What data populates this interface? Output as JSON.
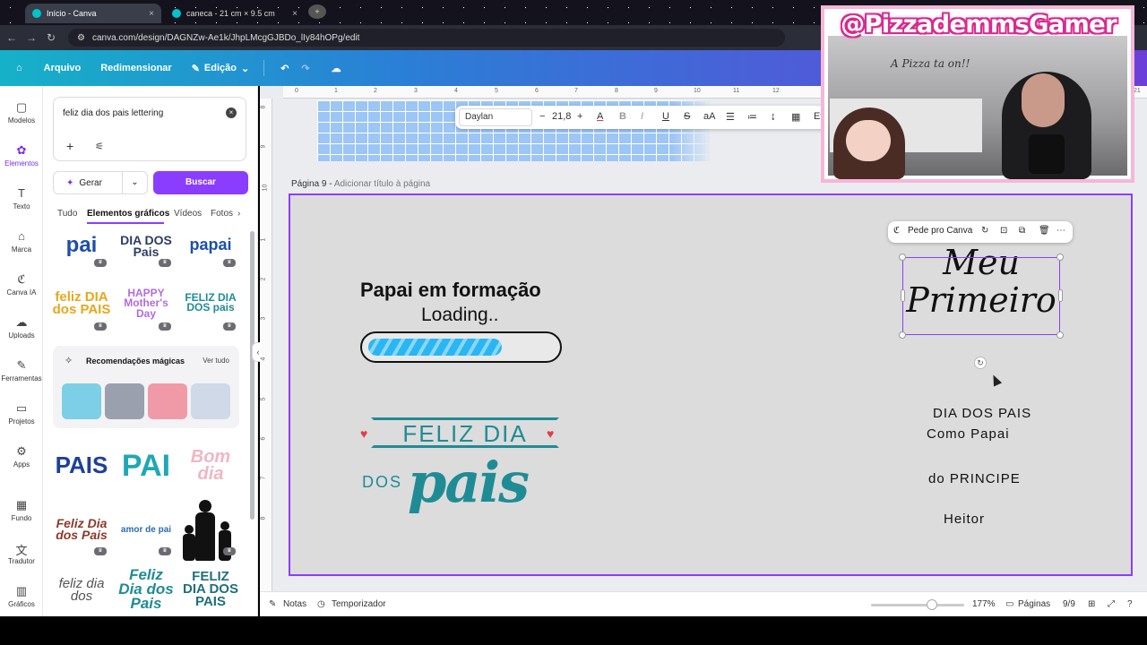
{
  "browser": {
    "tabs": [
      {
        "label": "Início - Canva",
        "active": true
      },
      {
        "label": "caneca - 21 cm × 9.5 cm",
        "active": false
      }
    ],
    "url": "canva.com/design/DAGNZw-Ae1k/JhpLMcgGJBDo_lIy84hOPg/edit"
  },
  "topbar": {
    "arquivo": "Arquivo",
    "redimensionar": "Redimensionar",
    "edicao": "Edição"
  },
  "rail": {
    "items": [
      "Modelos",
      "Elementos",
      "Texto",
      "Marca",
      "Canva IA",
      "Uploads",
      "Ferramentas",
      "Projetos",
      "Apps",
      "Fundo",
      "Tradutor",
      "Gráficos"
    ]
  },
  "panel": {
    "search_value": "feliz dia dos pais lettering",
    "gerar": "Gerar",
    "buscar": "Buscar",
    "tabs": [
      "Tudo",
      "Elementos gráficos",
      "Vídeos",
      "Fotos"
    ],
    "magic_title": "Recomendações mágicas",
    "magic_see_all": "Ver tudo",
    "thumbs": {
      "t1": "pai",
      "t2": "DIA DOS Pais",
      "t3": "papai",
      "t4": "feliz DIA dos PAIS",
      "t5": "HAPPY Mother's Day",
      "t6": "FELIZ DIA DOS pais",
      "t7": "PAIS",
      "t8": "PAI",
      "t9": "Bom dia",
      "t10": "Feliz Dia dos Pais",
      "t11": "amor de pai",
      "t12": "feliz dia dos",
      "t13": "Feliz Dia dos Pais",
      "t14": "FELIZ DIA DOS PAIS"
    }
  },
  "ruler": {
    "top": [
      "0",
      "1",
      "2",
      "3",
      "4",
      "5",
      "6",
      "7",
      "8",
      "9",
      "10",
      "11",
      "12",
      "21"
    ],
    "left": [
      "8",
      "9",
      "10",
      "1",
      "2",
      "3",
      "4",
      "5",
      "6",
      "7",
      "8"
    ]
  },
  "text_toolbar": {
    "font": "Daylan",
    "minus": "−",
    "size": "21,8",
    "plus": "+",
    "color_glyph": "A",
    "bold": "B",
    "italic": "I",
    "underline": "U",
    "strike": "S",
    "case": "aA",
    "efeitos": "Ef"
  },
  "page": {
    "label": "Página 9 -",
    "sublabel": "Adicionar título à página",
    "headline": "Papai em formação",
    "loading": "Loading..",
    "progress_fraction": 0.72,
    "feliz_banner": "FELIZ DIA",
    "feliz_dos": "DOS",
    "feliz_pais": "pais"
  },
  "context_toolbar": {
    "label": "Pede pro Canva"
  },
  "selected_text": {
    "line1": "Meu",
    "line2": "Primeiro"
  },
  "right_texts": {
    "dia_dos_pais": "DIA DOS PAIS",
    "como_papai": "Como Papai",
    "do_principe": "do PRINCIPE",
    "heitor": "Heitor"
  },
  "bottom": {
    "notas": "Notas",
    "temporizador": "Temporizador",
    "zoom": "177%",
    "zoom_fraction": 0.65,
    "paginas": "Páginas",
    "page_count": "9/9"
  },
  "webcam": {
    "handle": "@PizzademmsGamer",
    "sign": "A Pizza ta on!!"
  },
  "colors": {
    "accent": "#8b3dff",
    "teal": "#1f8c95",
    "progress": "#2ab6f2"
  }
}
